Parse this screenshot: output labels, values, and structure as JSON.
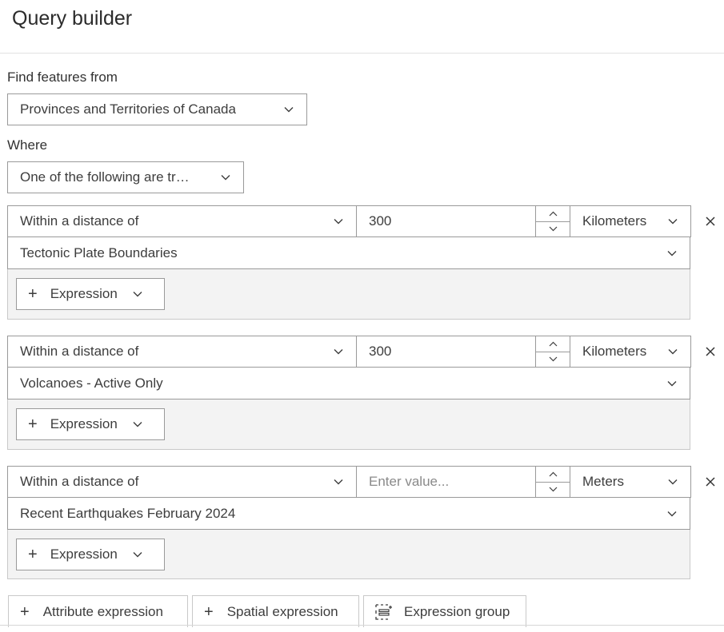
{
  "title": "Query builder",
  "find_label": "Find features from",
  "layer_select": "Provinces and Territories of Canada",
  "where_label": "Where",
  "logic_select": "One of the following are tr…",
  "expressions": [
    {
      "operator": "Within a distance of",
      "distance": "300",
      "distance_placeholder": "",
      "unit": "Kilometers",
      "layer": "Tectonic Plate Boundaries",
      "add_label": "Expression"
    },
    {
      "operator": "Within a distance of",
      "distance": "300",
      "distance_placeholder": "",
      "unit": "Kilometers",
      "layer": "Volcanoes - Active Only",
      "add_label": "Expression"
    },
    {
      "operator": "Within a distance of",
      "distance": "",
      "distance_placeholder": "Enter value...",
      "unit": "Meters",
      "layer": "Recent Earthquakes February 2024",
      "add_label": "Expression"
    }
  ],
  "bottom_buttons": {
    "attribute": "Attribute expression",
    "spatial": "Spatial expression",
    "group": "Expression group"
  },
  "icons": {
    "chevron": "chevron-down-icon",
    "spin_up": "chevron-up-icon",
    "spin_down": "chevron-down-icon",
    "close": "close-icon",
    "add": "plus-icon",
    "group": "expression-group-icon"
  },
  "colors": {
    "border": "#9a9a9a",
    "panel": "#f3f3f3",
    "text": "#3d3d3d",
    "placeholder": "#8a8a8a"
  }
}
